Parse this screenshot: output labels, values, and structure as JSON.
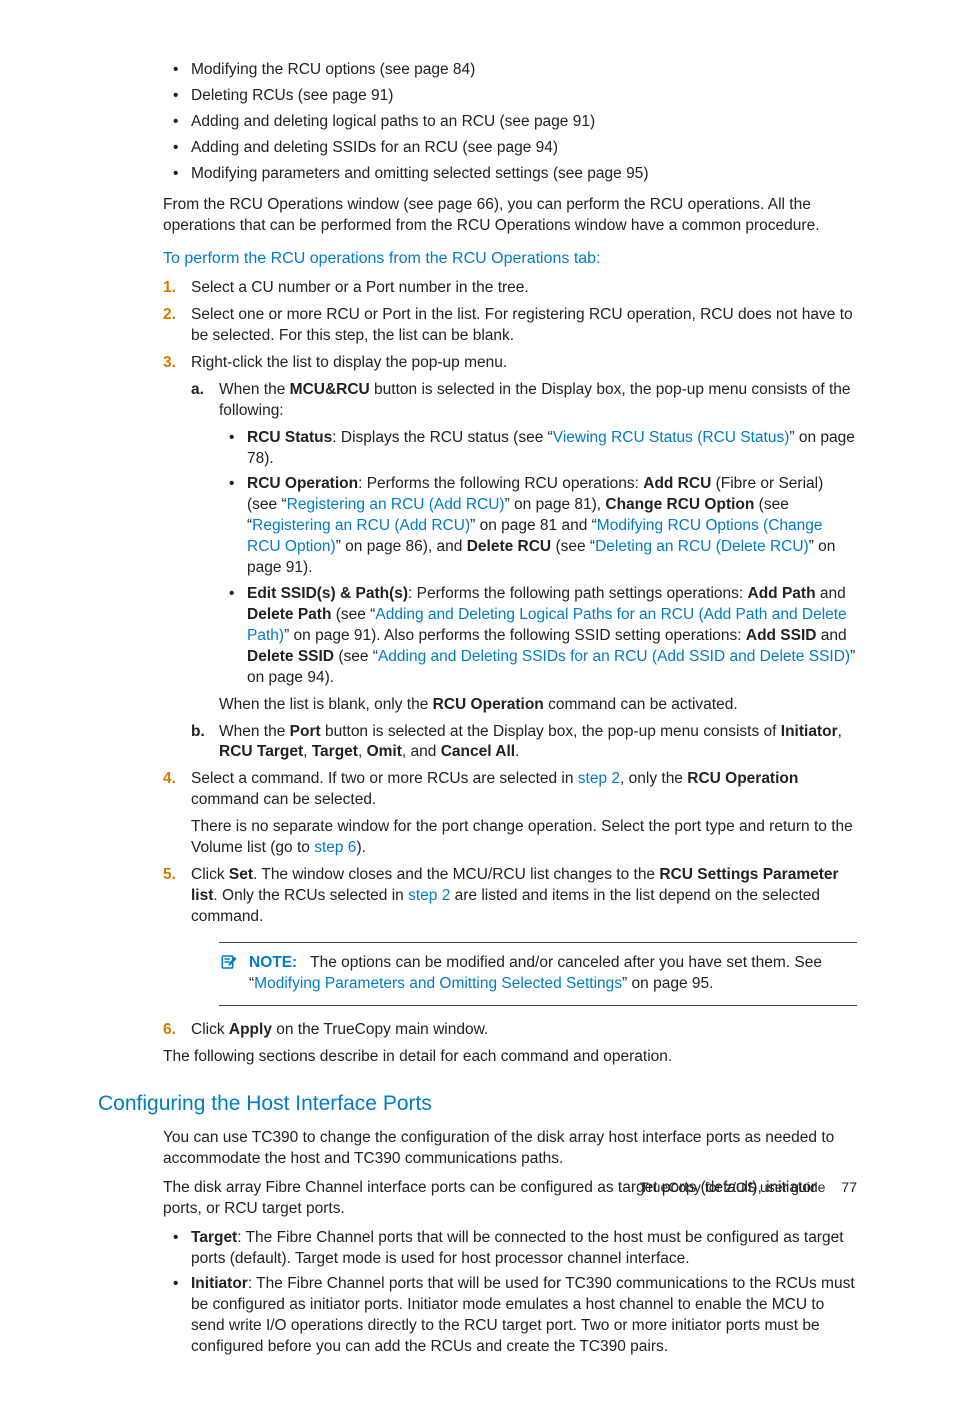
{
  "topBullets": [
    "Modifying the RCU options (see page 84)",
    "Deleting RCUs (see page 91)",
    "Adding and deleting logical paths to an RCU (see page 91)",
    "Adding and deleting SSIDs for an RCU (see page 94)",
    "Modifying parameters and omitting selected settings (see page 95)"
  ],
  "fromLine": "From the RCU Operations window (see page 66), you can perform the RCU operations. All the operations that can be performed from the RCU Operations window have a common procedure.",
  "procTitle": "To perform the RCU operations from the RCU Operations tab:",
  "step1": "Select a CU number or a Port number in the tree.",
  "step2": "Select one or more RCU or Port in the list. For registering RCU operation, RCU does not have to be selected. For this step, the list can be blank.",
  "step3_intro": "Right-click the list to display the pop-up menu.",
  "step3a_pre": "When the ",
  "step3a_bold": "MCU&RCU",
  "step3a_post": " button is selected in the Display box, the pop-up menu consists of the following:",
  "rcuStatus_label": "RCU Status",
  "rcuStatus_text1": ": Displays the RCU status (see “",
  "rcuStatus_link": "Viewing RCU Status (RCU Status)",
  "rcuStatus_text2": "” on page 78).",
  "rcuOp_label": "RCU Operation",
  "rcuOp_t1": ": Performs the following RCU operations: ",
  "rcuOp_add": "Add RCU",
  "rcuOp_t2": " (Fibre or Serial) (see “",
  "rcuOp_link1": "Registering an RCU (Add RCU)",
  "rcuOp_t3": "” on page 81), ",
  "rcuOp_change": "Change RCU Option",
  "rcuOp_t4": " (see “",
  "rcuOp_link2": "Registering an RCU (Add RCU)",
  "rcuOp_t5": "” on page 81 and “",
  "rcuOp_link3": "Modifying RCU Options (Change RCU Option)",
  "rcuOp_t6": "” on page 86), and ",
  "rcuOp_delete": "Delete RCU",
  "rcuOp_t7": " (see “",
  "rcuOp_link4": "Deleting an RCU (Delete RCU)",
  "rcuOp_t8": "” on page 91).",
  "edit_label": "Edit SSID(s) & Path(s)",
  "edit_t1": ": Performs the following path settings operations: ",
  "edit_addpath": "Add Path",
  "edit_and": " and ",
  "edit_delpath": "Delete Path",
  "edit_t2": " (see “",
  "edit_link1": "Adding and Deleting Logical Paths for an RCU (Add Path and Delete Path)",
  "edit_t3": "” on page 91). Also performs the following SSID setting operations: ",
  "edit_addssid": "Add SSID",
  "edit_delssid": "Delete SSID",
  "edit_t4": " (see “",
  "edit_link2": "Adding and Deleting SSIDs for an RCU (Add SSID and Delete SSID)",
  "edit_t5": "” on page 94).",
  "blankline_pre": "When the list is blank, only the ",
  "blankline_b": "RCU Operation",
  "blankline_post": " command can be activated.",
  "step3b_pre": "When the ",
  "step3b_port": "Port",
  "step3b_mid": " button is selected at the Display box, the pop-up menu consists of ",
  "step3b_initiator": "Initiator",
  "step3b_sep1": ", ",
  "step3b_rcutarget": "RCU Target",
  "step3b_target": "Target",
  "step3b_omit": "Omit",
  "step3b_sep3": ", and ",
  "step3b_cancel": "Cancel All",
  "step3b_end": ".",
  "step4_t1": "Select a command. If two or more RCUs are selected in ",
  "step4_link": "step 2",
  "step4_t2": ", only the ",
  "step4_b": "RCU Operation",
  "step4_t3": " command can be selected.",
  "step4_p2a": "There is no separate window for the port change operation. Select the port type and return to the Volume list (go to ",
  "step4_p2link": "step 6",
  "step4_p2b": ").",
  "step5_t1": "Click ",
  "step5_set": "Set",
  "step5_t2": ". The window closes and the MCU/RCU list changes to the ",
  "step5_b2": "RCU Settings Parameter list",
  "step5_t3": ". Only the RCUs selected in ",
  "step5_link": "step 2",
  "step5_t4": " are listed and items in the list depend on the selected command.",
  "note_label": "NOTE:",
  "note_t1": "The options can be modified and/or canceled after you have set them. See “",
  "note_link": "Modifying Parameters and Omitting Selected Settings",
  "note_t2": "” on page 95.",
  "step6_t1": "Click ",
  "step6_b": "Apply",
  "step6_t2": " on the TrueCopy main window.",
  "following": "The following sections describe in detail for each command and operation.",
  "h2": "Configuring the Host Interface Ports",
  "sec_p1": "You can use TC390 to change the configuration of the disk array host interface ports as needed to accommodate the host and TC390 communications paths.",
  "sec_p2": "The disk array Fibre Channel interface ports can be configured as target ports (default), initiator ports, or RCU target ports.",
  "target_label": "Target",
  "target_text": ": The Fibre Channel ports that will be connected to the host must be configured as target ports (default). Target mode is used for host processor channel interface.",
  "init_label": "Initiator",
  "init_text": ": The Fibre Channel ports that will be used for TC390 communications to the RCUs must be configured as initiator ports. Initiator mode emulates a host channel to enable the MCU to send write I/O operations directly to the RCU target port. Two or more initiator ports must be configured before you can add the RCUs and create the TC390 pairs.",
  "footer_title": "TrueCopy for z/OS user guide",
  "footer_page": "77"
}
